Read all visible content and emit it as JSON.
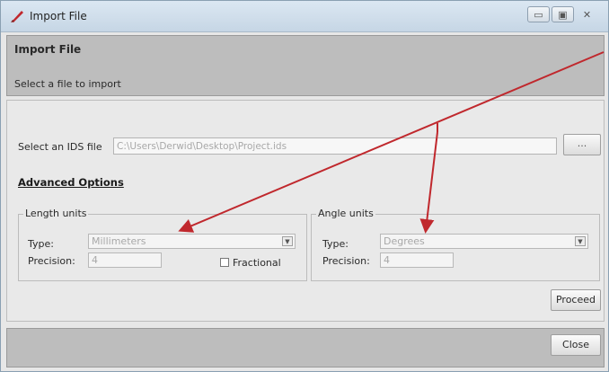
{
  "window": {
    "title": "Import File",
    "controls": {
      "minimize": "▭",
      "maximize": "▣",
      "close": "✕"
    }
  },
  "header": {
    "title": "Import File",
    "subtitle": "Select a file to import"
  },
  "file_select": {
    "label": "Select an IDS file",
    "value": "C:\\Users\\Derwid\\Desktop\\Project.ids",
    "browse_label": "..."
  },
  "advanced": {
    "link_label": "Advanced Options"
  },
  "length_units": {
    "legend": "Length units",
    "type_label": "Type:",
    "type_value": "Millimeters",
    "precision_label": "Precision:",
    "precision_value": "4",
    "fractional_label": "Fractional"
  },
  "angle_units": {
    "legend": "Angle units",
    "type_label": "Type:",
    "type_value": "Degrees",
    "precision_label": "Precision:",
    "precision_value": "4"
  },
  "actions": {
    "proceed_label": "Proceed",
    "close_label": "Close"
  },
  "colors": {
    "annotation_arrow": "#c0282d",
    "title_icon": "#c0282d"
  },
  "icons": {
    "title_icon": "app-icon",
    "dropdown_arrow": "chevron-down-icon"
  }
}
